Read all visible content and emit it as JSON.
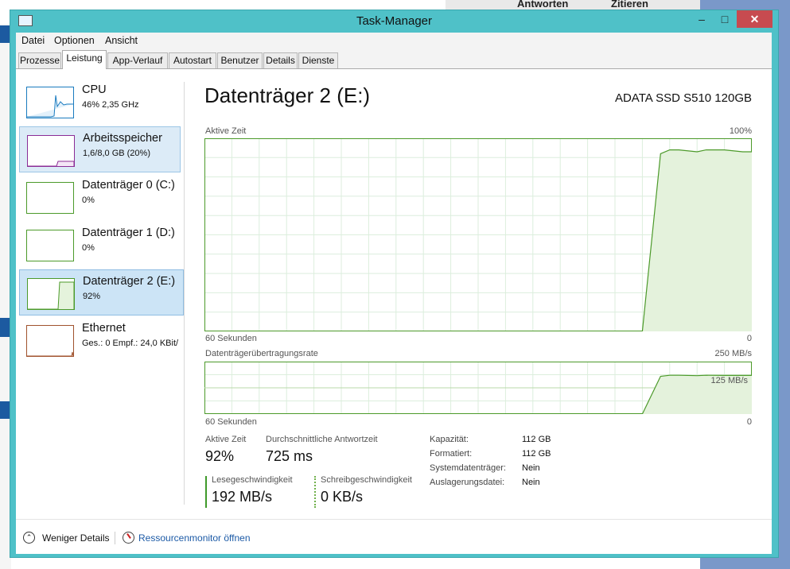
{
  "background": {
    "topbar_actions": [
      "Antworten",
      "Zitieren"
    ]
  },
  "window": {
    "title": "Task-Manager",
    "controls": [
      "–",
      "□",
      "✕"
    ]
  },
  "menu": [
    "Datei",
    "Optionen",
    "Ansicht"
  ],
  "tabs": [
    "Prozesse",
    "Leistung",
    "App-Verlauf",
    "Autostart",
    "Benutzer",
    "Details",
    "Dienste"
  ],
  "active_tab": "Leistung",
  "sidebar": [
    {
      "name": "CPU",
      "value": "46% 2,35 GHz",
      "color": "#1a7bbf"
    },
    {
      "name": "Arbeitsspeicher",
      "value": "1,6/8,0 GB (20%)",
      "color": "#8b2c96"
    },
    {
      "name": "Datenträger 0 (C:)",
      "value": "0%",
      "color": "#4c9a2a"
    },
    {
      "name": "Datenträger 1 (D:)",
      "value": "0%",
      "color": "#4c9a2a"
    },
    {
      "name": "Datenträger 2 (E:)",
      "value": "92%",
      "color": "#4c9a2a"
    },
    {
      "name": "Ethernet",
      "value": "Ges.: 0 Empf.: 24,0 KBit/",
      "color": "#a0522d"
    }
  ],
  "detail": {
    "title": "Datenträger 2 (E:)",
    "model": "ADATA SSD S510 120GB",
    "graph1": {
      "label": "Aktive Zeit",
      "max_label": "100%",
      "x_left": "60 Sekunden",
      "x_right": "0"
    },
    "graph2": {
      "label": "Datenträgerübertragungsrate",
      "max_label": "250 MB/s",
      "mid_label": "125 MB/s",
      "x_left": "60 Sekunden",
      "x_right": "0"
    },
    "stats": {
      "active_time_label": "Aktive Zeit",
      "active_time_value": "92%",
      "response_label": "Durchschnittliche Antwortzeit",
      "response_value": "725 ms",
      "read_label": "Lesegeschwindigkeit",
      "read_value": "192 MB/s",
      "write_label": "Schreibgeschwindigkeit",
      "write_value": "0 KB/s"
    },
    "properties": [
      {
        "label": "Kapazität:",
        "value": "112 GB"
      },
      {
        "label": "Formatiert:",
        "value": "112 GB"
      },
      {
        "label": "Systemdatenträger:",
        "value": "Nein"
      },
      {
        "label": "Auslagerungsdatei:",
        "value": "Nein"
      }
    ]
  },
  "chart_data": [
    {
      "type": "area",
      "title": "Aktive Zeit",
      "xlabel": "60 Sekunden",
      "ylim": [
        0,
        100
      ],
      "x": [
        60,
        57,
        54,
        51,
        48,
        45,
        42,
        39,
        36,
        33,
        30,
        27,
        24,
        21,
        18,
        15,
        12,
        10,
        9,
        8,
        6,
        5,
        3,
        1,
        0
      ],
      "series": [
        {
          "values": [
            0,
            0,
            0,
            0,
            0,
            0,
            0,
            0,
            0,
            0,
            0,
            0,
            0,
            0,
            0,
            0,
            0,
            92,
            94,
            94,
            93,
            94,
            94,
            93,
            93
          ]
        }
      ]
    },
    {
      "type": "area",
      "title": "Datenträgerübertragungsrate",
      "xlabel": "60 Sekunden",
      "ylabel": "MB/s",
      "ylim": [
        0,
        250
      ],
      "x": [
        60,
        57,
        54,
        51,
        48,
        45,
        42,
        39,
        36,
        33,
        30,
        27,
        24,
        21,
        18,
        15,
        12,
        10,
        9,
        8,
        6,
        5,
        3,
        1,
        0
      ],
      "series": [
        {
          "values": [
            0,
            0,
            0,
            0,
            0,
            0,
            0,
            0,
            0,
            0,
            0,
            0,
            0,
            0,
            0,
            0,
            0,
            180,
            185,
            185,
            183,
            185,
            184,
            184,
            184
          ]
        }
      ]
    }
  ],
  "footer": {
    "less_details": "Weniger Details",
    "resource_monitor": "Ressourcenmonitor öffnen"
  }
}
